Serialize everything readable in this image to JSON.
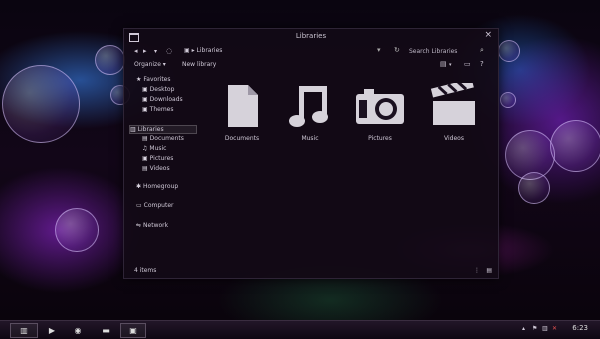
{
  "window": {
    "title": "Libraries"
  },
  "navbar": {
    "back_icon": "back-arrow-icon",
    "forward_icon": "forward-arrow-icon",
    "breadcrumb": "Libraries",
    "search_placeholder": "Search Libraries"
  },
  "toolbar": {
    "organize_label": "Organize ▾",
    "new_library_label": "New library"
  },
  "sidebar": {
    "favorites": {
      "label": "Favorites",
      "items": [
        "Desktop",
        "Downloads",
        "Themes"
      ]
    },
    "libraries": {
      "label": "Libraries",
      "items": [
        "Documents",
        "Music",
        "Pictures",
        "Videos"
      ]
    },
    "homegroup": "Homegroup",
    "computer": "Computer",
    "network": "Network"
  },
  "libraries": [
    {
      "name": "Documents",
      "icon": "document-icon"
    },
    {
      "name": "Music",
      "icon": "music-icon"
    },
    {
      "name": "Pictures",
      "icon": "camera-icon"
    },
    {
      "name": "Videos",
      "icon": "clapperboard-icon"
    }
  ],
  "status": {
    "item_count": "4 items"
  },
  "taskbar": {
    "clock": "6:23"
  },
  "colors": {
    "accent": "#c8c2d0",
    "window_bg": "#120a16",
    "taskbar_bg": "#1a1020"
  }
}
